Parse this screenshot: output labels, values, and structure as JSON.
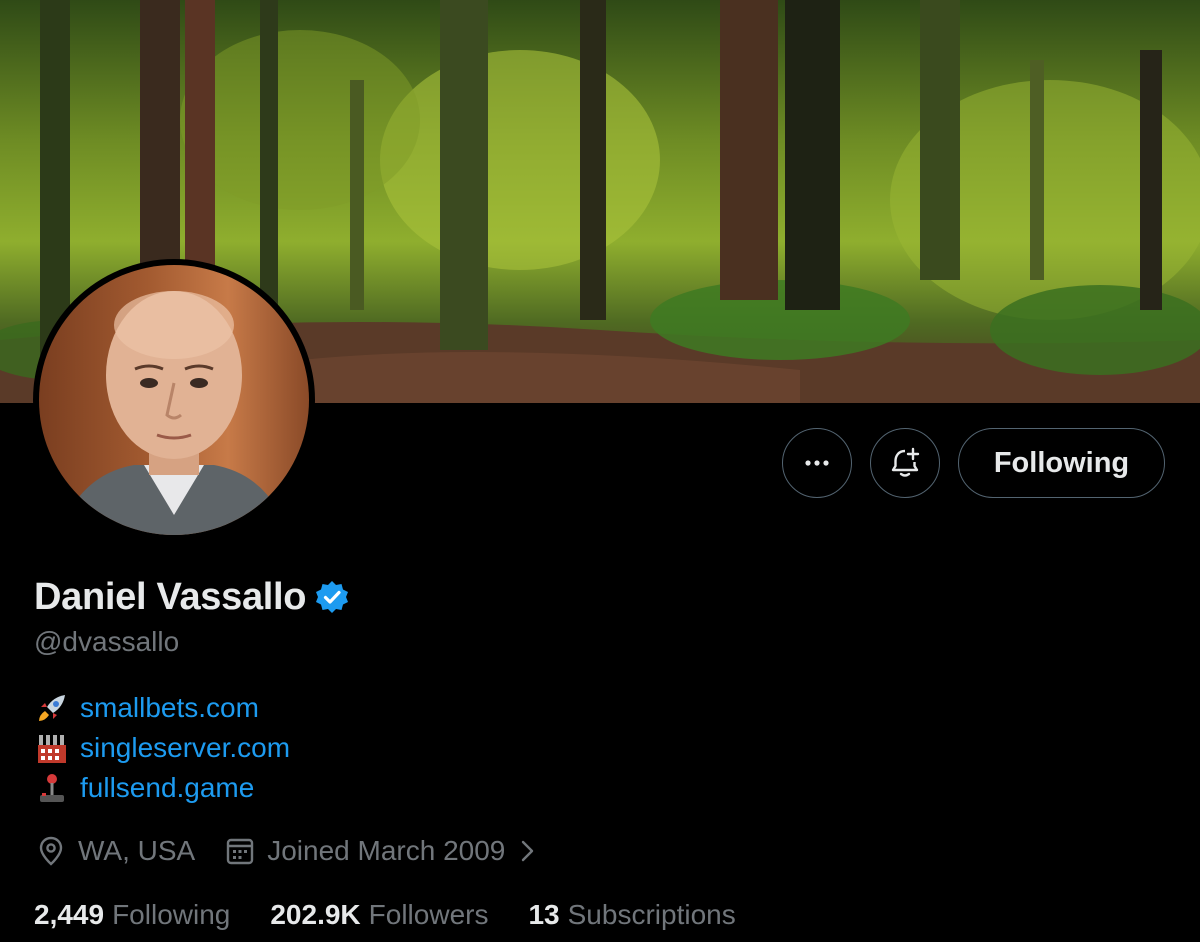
{
  "profile": {
    "display_name": "Daniel Vassallo",
    "handle": "@dvassallo",
    "verified": true
  },
  "actions": {
    "more_icon": "more-horizontal-icon",
    "notify_icon": "bell-plus-icon",
    "follow_label": "Following"
  },
  "bio": {
    "links": [
      {
        "emoji": "rocket-icon",
        "text": "smallbets.com"
      },
      {
        "emoji": "factory-icon",
        "text": "singleserver.com"
      },
      {
        "emoji": "joystick-icon",
        "text": "fullsend.game"
      }
    ]
  },
  "meta": {
    "location": "WA, USA",
    "joined": "Joined March 2009"
  },
  "stats": {
    "following_count": "2,449",
    "following_label": "Following",
    "followers_count": "202.9K",
    "followers_label": "Followers",
    "subscriptions_count": "13",
    "subscriptions_label": "Subscriptions"
  },
  "colors": {
    "background": "#000000",
    "text_primary": "#e7e9ea",
    "text_secondary": "#71767b",
    "link": "#1d9bf0",
    "verified": "#1d9bf0",
    "border": "#536471"
  }
}
